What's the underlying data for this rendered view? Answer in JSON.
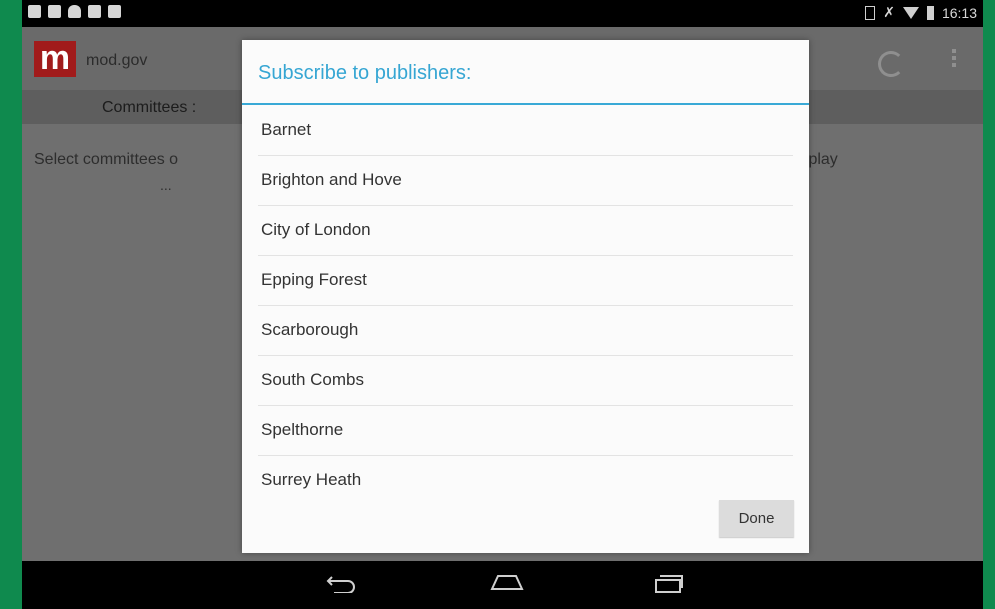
{
  "status_bar": {
    "time": "16:13"
  },
  "app": {
    "logo_letter": "m",
    "name": "mod.gov"
  },
  "tabs": {
    "committees": "Committees :"
  },
  "background": {
    "message_left": "Select committees o",
    "message_right": "display",
    "ellipsis": "..."
  },
  "dialog": {
    "title": "Subscribe to publishers:",
    "items": [
      "Barnet",
      "Brighton and Hove",
      "City of London",
      "Epping Forest",
      "Scarborough",
      "South Combs",
      "Spelthorne",
      "Surrey Heath"
    ],
    "done_label": "Done"
  },
  "colors": {
    "accent": "#36a6d3",
    "logo_bg": "#a11b1b",
    "frame": "#0f8a4e"
  }
}
